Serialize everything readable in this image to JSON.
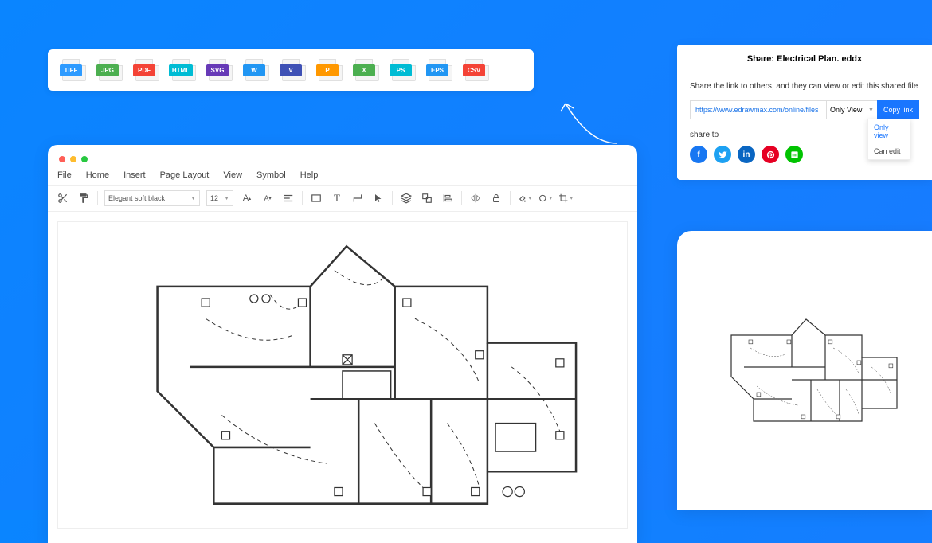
{
  "export_formats": [
    {
      "label": "TIFF",
      "cls": "fmt-tiff"
    },
    {
      "label": "JPG",
      "cls": "fmt-jpg"
    },
    {
      "label": "PDF",
      "cls": "fmt-pdf"
    },
    {
      "label": "HTML",
      "cls": "fmt-html"
    },
    {
      "label": "SVG",
      "cls": "fmt-svg"
    },
    {
      "label": "W",
      "cls": "fmt-w"
    },
    {
      "label": "V",
      "cls": "fmt-v"
    },
    {
      "label": "P",
      "cls": "fmt-p"
    },
    {
      "label": "X",
      "cls": "fmt-x"
    },
    {
      "label": "PS",
      "cls": "fmt-ps"
    },
    {
      "label": "EPS",
      "cls": "fmt-eps"
    },
    {
      "label": "CSV",
      "cls": "fmt-csv"
    }
  ],
  "editor": {
    "menu": [
      "File",
      "Home",
      "Insert",
      "Page Layout",
      "View",
      "Symbol",
      "Help"
    ],
    "font": "Elegant soft black",
    "font_size": "12"
  },
  "share": {
    "title": "Share: Electrical Plan. eddx",
    "desc": "Share the link to others, and they can view or edit this shared file",
    "url": "https://www.edrawmax.com/online/files",
    "perm": "Only View",
    "copy": "Copy link",
    "perm_opts": {
      "view": "Only view",
      "edit": "Can edit"
    },
    "share_to": "share to"
  }
}
